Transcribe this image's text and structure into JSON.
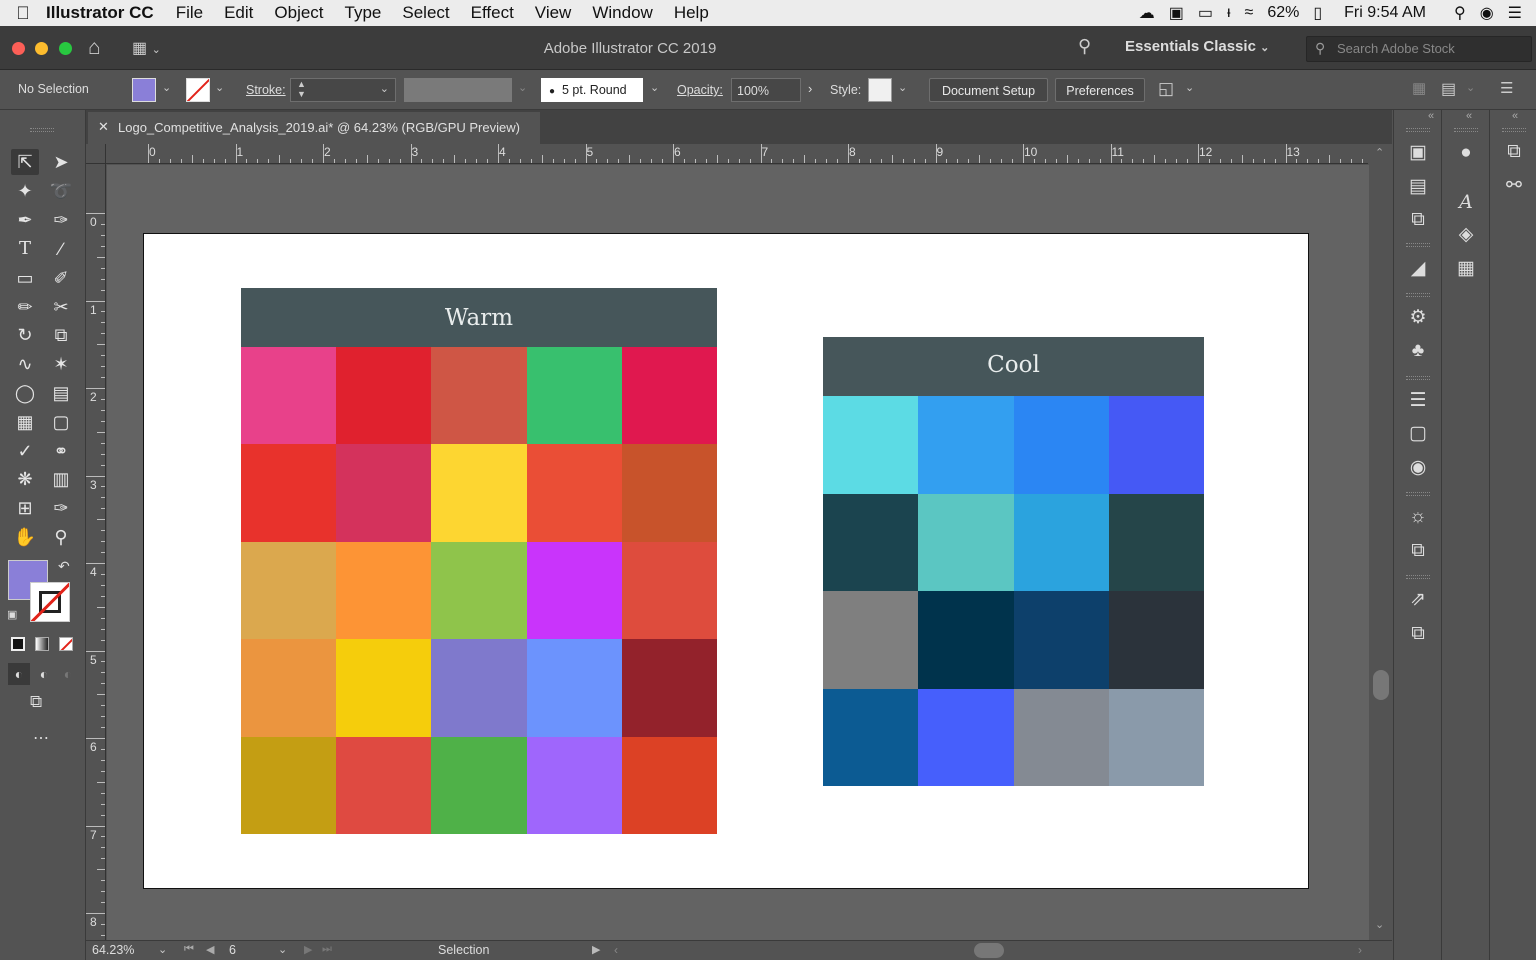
{
  "menubar": {
    "app": "Illustrator CC",
    "items": [
      "File",
      "Edit",
      "Object",
      "Type",
      "Select",
      "Effect",
      "View",
      "Window",
      "Help"
    ],
    "battery": "62%",
    "time": "Fri 9:54 AM"
  },
  "titlebar": {
    "title": "Adobe Illustrator CC 2019",
    "workspace": "Essentials Classic",
    "search_placeholder": "Search Adobe Stock"
  },
  "controlbar": {
    "selection_label": "No Selection",
    "fill_color": "#8a7fd8",
    "stroke_label": "Stroke:",
    "brush_label": "5 pt. Round",
    "opacity_label": "Opacity:",
    "opacity_value": "100%",
    "style_label": "Style:",
    "document_setup": "Document Setup",
    "preferences": "Preferences"
  },
  "document": {
    "tab_title": "Logo_Competitive_Analysis_2019.ai* @ 64.23% (RGB/GPU Preview)"
  },
  "rulers": {
    "horizontal": [
      "0",
      "1",
      "2",
      "3",
      "4",
      "5",
      "6",
      "7",
      "8",
      "9",
      "10",
      "11",
      "12",
      "13"
    ],
    "vertical": [
      "0",
      "1",
      "2",
      "3",
      "4",
      "5",
      "6",
      "7",
      "8"
    ]
  },
  "warm": {
    "title": "Warm",
    "colors": [
      "#e8418a",
      "#e0212e",
      "#cf5645",
      "#38c06e",
      "#e0184f",
      "#e8322c",
      "#d4325c",
      "#fdd631",
      "#ea4e36",
      "#c8532b",
      "#dba84e",
      "#fd9435",
      "#8fc44b",
      "#c934fb",
      "#de4c3d",
      "#eb953f",
      "#f5cd0c",
      "#7f79cc",
      "#6c93fd",
      "#93222b",
      "#c49e13",
      "#df4a41",
      "#4fb148",
      "#9f66fc",
      "#dc4125"
    ]
  },
  "cool": {
    "title": "Cool",
    "colors": [
      "#5cdbe4",
      "#339ff0",
      "#2b86f3",
      "#4559f5",
      "#1b444f",
      "#5bc6c2",
      "#2ba3de",
      "#254549",
      "#7f7f7f",
      "#00334c",
      "#0d406b",
      "#2b333b",
      "#0c5b93",
      "#465ffc",
      "#848a93",
      "#8a9aaa"
    ]
  },
  "statusbar": {
    "zoom": "64.23%",
    "artboard": "6",
    "tool": "Selection"
  }
}
